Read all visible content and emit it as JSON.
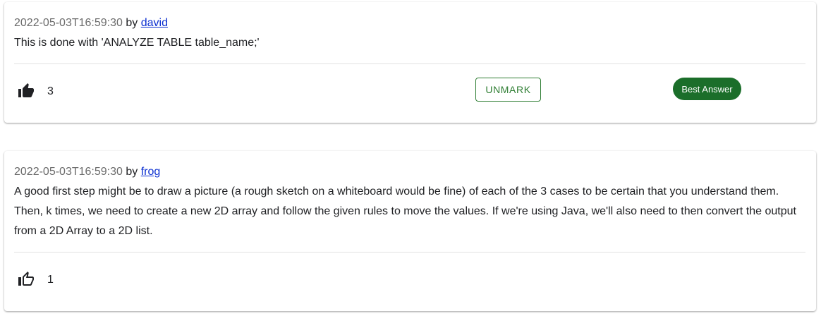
{
  "answers": [
    {
      "timestamp": "2022-05-03T16:59:30",
      "by": "by",
      "author": "david",
      "body": "This is done with 'ANALYZE TABLE table_name;'",
      "likes": "3",
      "liked": true,
      "unmark_label": "UNMARK",
      "badge": "Best Answer"
    },
    {
      "timestamp": "2022-05-03T16:59:30",
      "by": "by",
      "author": "frog",
      "body": "A good first step might be to draw a picture (a rough sketch on a whiteboard would be fine) of each of the 3 cases to be certain that you understand them. Then, k times, we need to create a new 2D array and follow the given rules to move the values. If we're using Java, we'll also need to then convert the output from a 2D Array to a 2D list.",
      "likes": "1",
      "liked": false
    }
  ],
  "colors": {
    "accent_green": "#2e7d32",
    "badge_green": "#1b6e2a",
    "link_blue": "#0b2fd0"
  },
  "icons": {
    "liked": "thumb-up-filled-icon",
    "not_liked": "thumb-up-outline-icon"
  }
}
